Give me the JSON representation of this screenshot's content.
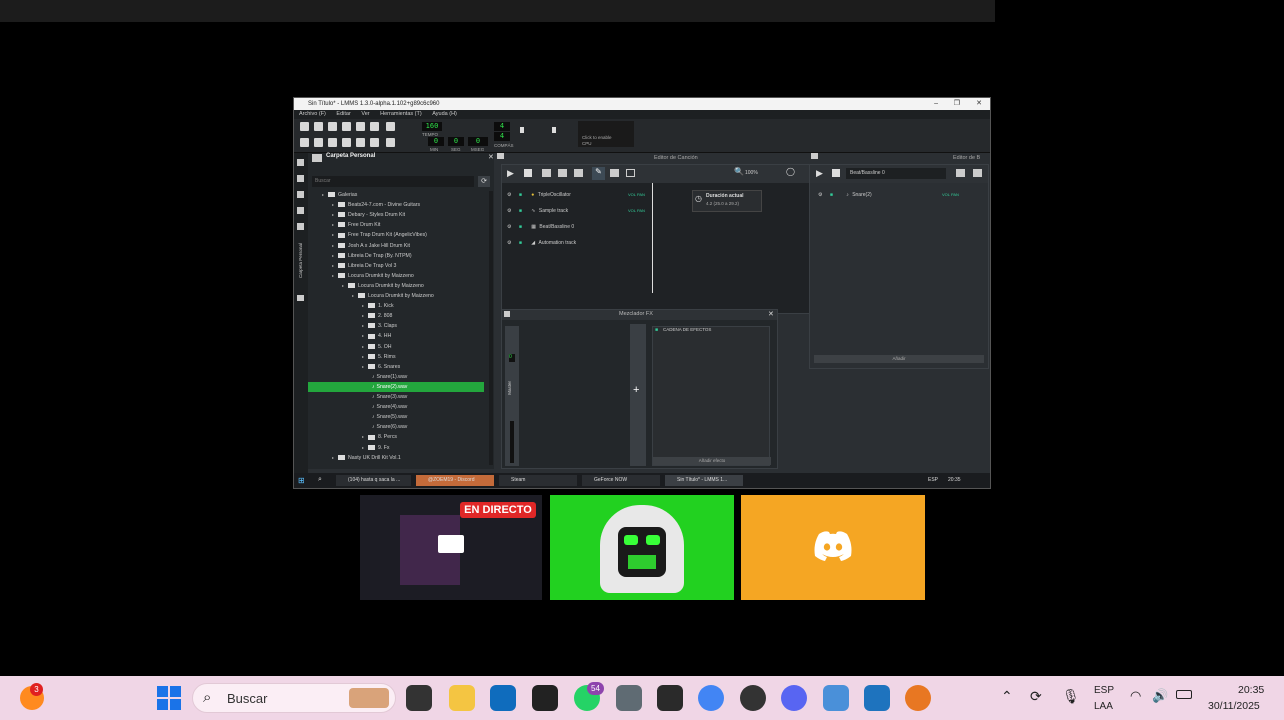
{
  "lmms": {
    "window_title": "Sin Título* - LMMS 1.3.0-alpha.1.102+g89c6c960",
    "menu": [
      "Archivo (F)",
      "Editar",
      "Ver",
      "Herramientas (T)",
      "Ayuda (H)"
    ],
    "tempo_label": "TEMPO",
    "tempo_value": "160",
    "time_sig_top": "4",
    "time_sig_bottom": "4",
    "time_sig_label": "COMPÁS",
    "time_min": "0",
    "time_sec": "0",
    "time_msec": "0",
    "time_labels": [
      "MIN",
      "SEG",
      "MSEG"
    ],
    "cpu_hint": "Click to enable",
    "cpu_label": "CPU",
    "browser": {
      "title": "Carpeta Personal",
      "search_placeholder": "Buscar",
      "side_label": "Carpeta Personal",
      "items": [
        {
          "label": "Galerias",
          "indent": 1
        },
        {
          "label": "Beats24-7.com - Divine Guitars",
          "indent": 2
        },
        {
          "label": "Debary - Styles Drum Kit",
          "indent": 2
        },
        {
          "label": "Free Drum Kit",
          "indent": 2
        },
        {
          "label": "Free Trap Drum Kit (AngelicVibes)",
          "indent": 2
        },
        {
          "label": "Josh A x Jake Hill Drum Kit",
          "indent": 2
        },
        {
          "label": "Libreia De Trap (By. NTPM)",
          "indent": 2
        },
        {
          "label": "Libreia De Trap Vol 3",
          "indent": 2
        },
        {
          "label": "Locura Drumkit by Maizzeno",
          "indent": 2
        },
        {
          "label": "Locura Drumkit by Maizzeno",
          "indent": 3
        },
        {
          "label": "Locura Drumkit by Maizzeno",
          "indent": 4
        },
        {
          "label": "1. Kick",
          "indent": 5
        },
        {
          "label": "2. 808",
          "indent": 5
        },
        {
          "label": "3. Claps",
          "indent": 5
        },
        {
          "label": "4. HH",
          "indent": 5
        },
        {
          "label": "5. OH",
          "indent": 5
        },
        {
          "label": "5. Rims",
          "indent": 5
        },
        {
          "label": "6. Snares",
          "indent": 5
        },
        {
          "label": "Snare(1).wav",
          "indent": 6
        },
        {
          "label": "Snare(2).wav",
          "indent": 6,
          "selected": true
        },
        {
          "label": "Snare(3).wav",
          "indent": 6
        },
        {
          "label": "Snare(4).wav",
          "indent": 6
        },
        {
          "label": "Snare(5).wav",
          "indent": 6
        },
        {
          "label": "Snare(6).wav",
          "indent": 6
        },
        {
          "label": "8. Percs",
          "indent": 5
        },
        {
          "label": "9. Fx",
          "indent": 5
        },
        {
          "label": "Nasty UK Drill Kit Vol.1",
          "indent": 2
        }
      ]
    },
    "song_editor": {
      "title": "Editor de Canción",
      "zoom": "100%",
      "tooltip_title": "Duración actual",
      "tooltip_value": "4.2 (25.0 a 29.2)",
      "tracks": [
        "TripleOscillator",
        "Sample track",
        "Beat/Bassline 0",
        "Automation track"
      ],
      "vol_pan": "VOL PAN"
    },
    "mixer": {
      "title": "Mezclador FX",
      "master_label": "Master",
      "master_value": "0",
      "fx_chain": "CADENA DE EFECTOS",
      "add_effect": "Añadir efecto"
    },
    "beat_editor": {
      "title": "Editor de B",
      "pattern": "Beat/Bassline 0",
      "instrument": "Snare(2)",
      "add_button": "Añadir",
      "vol_pan": "VOL PAN"
    },
    "inner_taskbar": {
      "tasks": [
        "(104) hasta q saca la ...",
        "@ZOEM19 - Discord",
        "Steam",
        "GeForce NOW",
        "Sin Título* - LMMS 1..."
      ],
      "lang": "ESP",
      "time": "20:35"
    }
  },
  "stream": {
    "live_badge": "EN DIRECTO"
  },
  "taskbar": {
    "search_placeholder": "Buscar",
    "whatsapp_badge": "54",
    "firefox_badge": "3",
    "lang_top": "ESP",
    "lang_bottom": "LAA",
    "time": "20:35",
    "date": "30/11/2025"
  },
  "colors": {
    "lmms_bg": "#2b2f33",
    "lmms_green": "#23a63d",
    "cam_green": "#22d120",
    "discord_tile": "#f5a623",
    "taskbar_bg": "#f0d6e6",
    "live_red": "#e02727"
  }
}
